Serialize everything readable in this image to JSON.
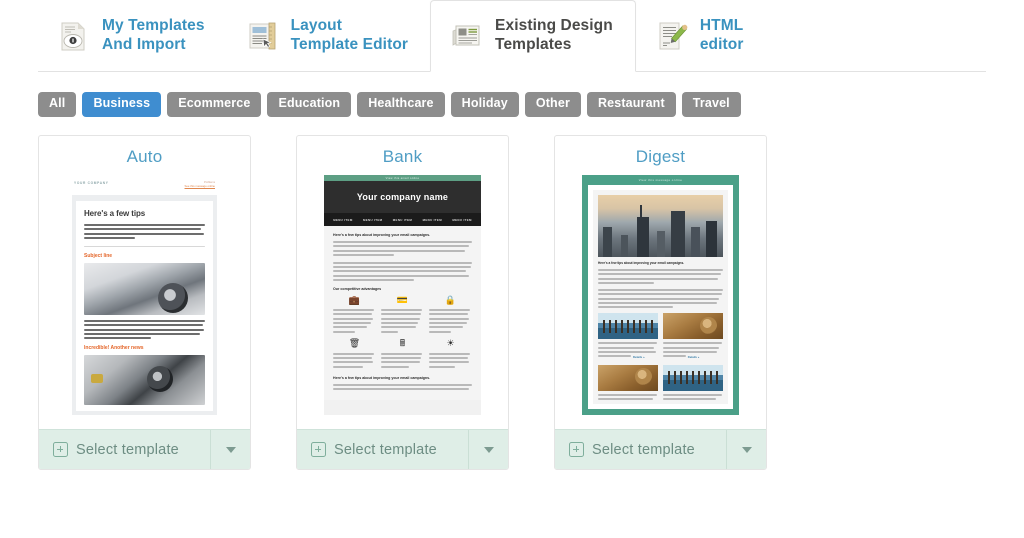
{
  "tabs": [
    {
      "label": "My Templates\nAnd Import",
      "icon": "document-lock-icon",
      "active": false
    },
    {
      "label": "Layout\nTemplate Editor",
      "icon": "layout-ruler-icon",
      "active": false
    },
    {
      "label": "Existing Design\nTemplates",
      "icon": "newspaper-icon",
      "active": true
    },
    {
      "label": "HTML\neditor",
      "icon": "document-pencil-icon",
      "active": false
    }
  ],
  "filters": {
    "items": [
      {
        "label": "All",
        "selected": false
      },
      {
        "label": "Business",
        "selected": true
      },
      {
        "label": "Ecommerce",
        "selected": false
      },
      {
        "label": "Education",
        "selected": false
      },
      {
        "label": "Healthcare",
        "selected": false
      },
      {
        "label": "Holiday",
        "selected": false
      },
      {
        "label": "Other",
        "selected": false
      },
      {
        "label": "Restaurant",
        "selected": false
      },
      {
        "label": "Travel",
        "selected": false
      }
    ]
  },
  "cards": [
    {
      "title": "Auto",
      "select_label": "Select template",
      "preview": {
        "brand": "YOUR COMPANY",
        "link_small": "Problems",
        "link_small2": "See this message online",
        "heading": "Here's a few tips",
        "paragraph": "It's best to use your full name and the name of your company, such as \"John Smith, {{cc_cc_email_sender_company}}\". This will let your recipients understand who is writing to them without opening the email.",
        "subject_line": "Subject line",
        "second_paragraph": "It never hurts to remind the reader how they subscribed to your emails, like filled a form on your website, made a purchase from you, etc. This short sentence shows them that you are not a stranger, that they actually contacted you in one way or another and that gives you the permission to write to them. You can put that information in the footer of your email.",
        "news_heading": "Incredible! Another news"
      }
    },
    {
      "title": "Bank",
      "select_label": "Select template",
      "preview": {
        "top_bar": "View this email online",
        "company": "Your company name",
        "menu": [
          "MENU ITEM",
          "MENU ITEM",
          "MENU ITEM",
          "MENU ITEM",
          "MENU ITEM"
        ],
        "heading": "Here's a few tips about improving your email campaigns.",
        "paragraph": "It's best to use your full name and the name of your company, such as \"John Smith, {{cc_cc_email_sender_company}}\". This will let your recipients understand who is writing to them without opening the email.",
        "paragraph2": "It never hurts to remind the reader how they subscribed to your emails, like filled a form on your website, made a purchase from you, etc. This short sentence shows them that you are not a stranger, that they actually contacted you in one way or another and that gives you the permission to write to them. You can put that information in the footer of your email.",
        "advantages_heading": "Our competitive advantages",
        "advantages": [
          {
            "icon": "briefcase-icon",
            "text": "Create an email template that matches the style of your website. The logo and familiar colors will help the reader recognize you even if you do not send too often."
          },
          {
            "icon": "card-icon",
            "text": "Use your subscriber's name in the beginning of your newsletter. The recipient is less likely to read an email starting with \"dear sir or madam\"."
          },
          {
            "icon": "lock-icon",
            "text": "Create an email template that matches the style of your website. The logo and familiar colors will help the reader recognize you even if you do not send too often."
          },
          {
            "icon": "trash-icon",
            "text": "Use your subscriber's name in the beginning of your newsletter. The recipient is less likely to read an email starting with \"dear sir or madam\"."
          },
          {
            "icon": "calculator-icon",
            "text": "Create an email template that matches the style of your website. The logo and familiar colors will help the reader recognize you even if you do not send too often."
          },
          {
            "icon": "piechart-icon",
            "text": "Use your subscriber's name in the beginning of your newsletter. The recipient is less likely to read an email starting with \"dear sir or madam\"."
          }
        ],
        "footer_heading": "Here's a few tips about improving your email campaigns."
      }
    },
    {
      "title": "Digest",
      "select_label": "Select template",
      "preview": {
        "top_bar": "View this message online",
        "heading": "Here's a few tips about improving your email campaigns.",
        "paragraph": "It's best to use your full name and the name of your company, such as \"John Smith, {{cc_cc_email_sender_company}}\". This will let your recipients understand who is writing to them without opening the email.",
        "paragraph2": "It never hurts to remind the reader how they subscribed to your emails, like filled a form on your website, made a purchase from you, etc. This short sentence shows them that you are not a stranger, that they actually contacted you in one way or another and that gives you the permission to write to them. You can put that information in the footer of your email.",
        "cell1": "Create an email template that matches the style of your website. The logo and familiar colors will help the reader recognize you even if you do not send too often.",
        "cell2": "Use your subscriber's name in the beginning of your newsletter. The recipient is less likely to read an email starting with \"dear sir or madam\".",
        "details_label": "Details »",
        "cell3": "It never hurts to remind the reader how they subscribed to your emails.",
        "cell4": "It's best to use your full name and the name of your company."
      }
    }
  ],
  "colors": {
    "tab_link": "#3a92bf",
    "tab_active_text": "#4a4a48",
    "pill_default": "#8d8d8d",
    "pill_selected": "#3f8dd0",
    "card_title": "#4f9dc4",
    "select_bar_bg": "#dfeee7",
    "select_text": "#6d8d83",
    "digest_accent": "#4ba088",
    "bank_header": "#2e2e2e",
    "auto_accent": "#e4662a"
  }
}
